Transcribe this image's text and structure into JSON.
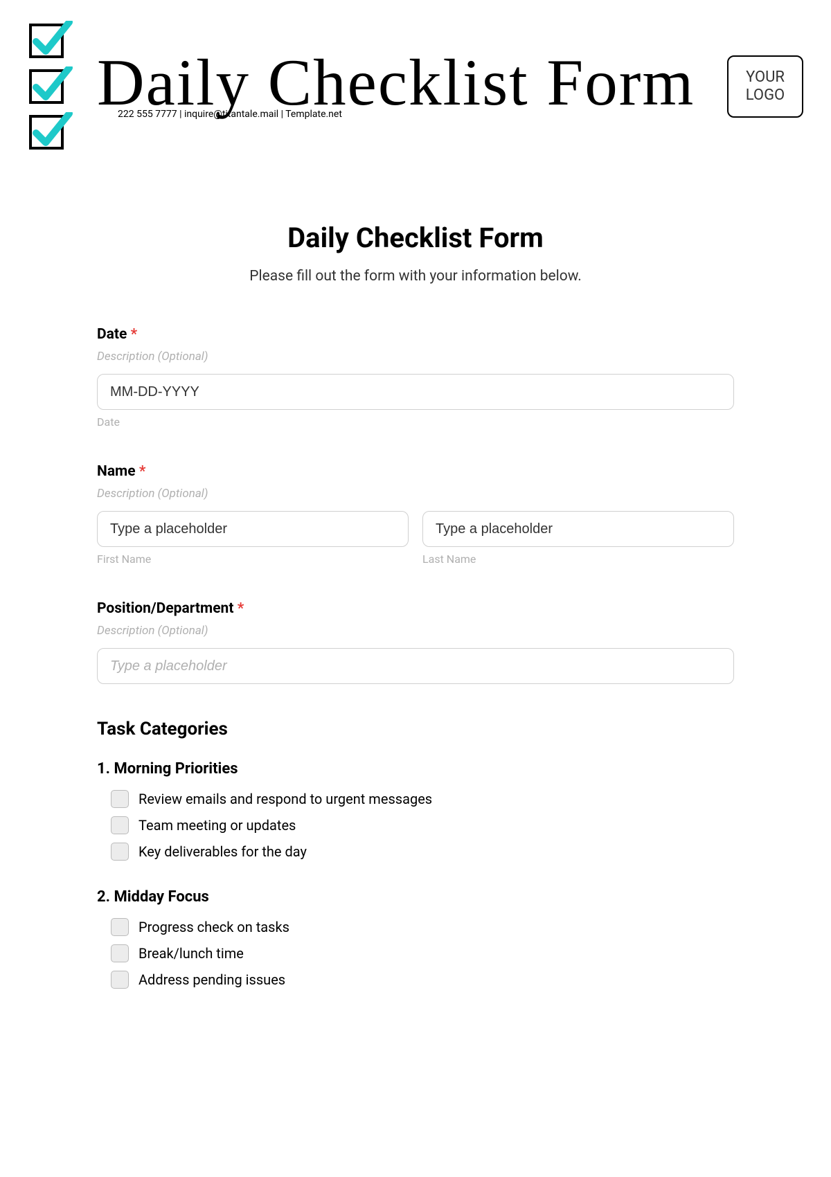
{
  "header": {
    "script_title": "Daily Checklist Form",
    "contact_line": "222 555 7777 | inquire@titantale.mail | Template.net",
    "logo_text": "YOUR LOGO"
  },
  "form": {
    "title": "Daily Checklist Form",
    "subtitle": "Please fill out the form with your information below.",
    "date": {
      "label": "Date",
      "desc": "Description (Optional)",
      "placeholder": "MM-DD-YYYY",
      "sub": "Date"
    },
    "name": {
      "label": "Name",
      "desc": "Description (Optional)",
      "first_placeholder": "Type a placeholder",
      "first_sub": "First Name",
      "last_placeholder": "Type a placeholder",
      "last_sub": "Last Name"
    },
    "position": {
      "label": "Position/Department",
      "desc": "Description (Optional)",
      "placeholder": "Type a placeholder"
    },
    "tasks_heading": "Task Categories",
    "categories": [
      {
        "title": "1. Morning Priorities",
        "items": [
          "Review emails and respond to urgent messages",
          "Team meeting or updates",
          "Key deliverables for the day"
        ]
      },
      {
        "title": "2. Midday Focus",
        "items": [
          "Progress check on tasks",
          "Break/lunch time",
          "Address pending issues"
        ]
      }
    ],
    "required_mark": "*"
  }
}
